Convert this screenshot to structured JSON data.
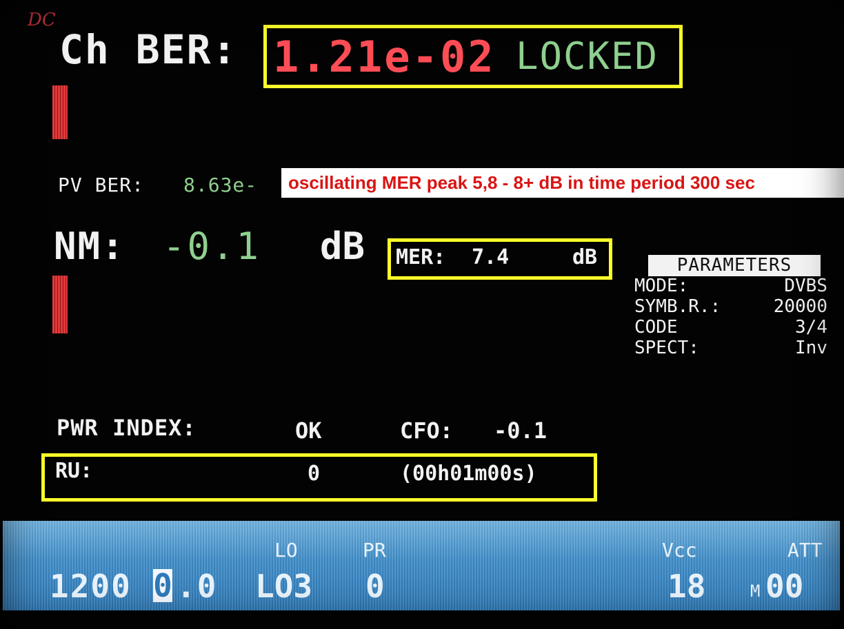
{
  "header": {
    "dc_label": "DC",
    "ch_ber_label": "Ch BER:",
    "ch_ber_value": "1.21e-02",
    "lock_status": "LOCKED"
  },
  "pv_ber": {
    "label": "PV BER:",
    "value": "8.63e-"
  },
  "annotation": "oscillating MER peak 5,8 - 8+ dB in time period 300 sec",
  "nm": {
    "label": "NM:",
    "value": "-0.1",
    "unit": "dB"
  },
  "mer": {
    "label": "MER:",
    "value": "7.4",
    "unit": "dB"
  },
  "parameters": {
    "title": "PARAMETERS",
    "rows": [
      {
        "key": "MODE:",
        "value": "DVBS"
      },
      {
        "key": "SYMB.R.:",
        "value": "20000"
      },
      {
        "key": "CODE",
        "value": "3/4"
      },
      {
        "key": "SPECT:",
        "value": "Inv"
      }
    ]
  },
  "pwr_index": {
    "label": "PWR INDEX:",
    "value": "OK"
  },
  "cfo": {
    "label": "CFO:",
    "value": "-0.1"
  },
  "ru": {
    "label": "RU:",
    "value": "0",
    "elapsed": "(00h01m00s)"
  },
  "status_bar": {
    "frequency_prefix": "1200",
    "frequency_cursor_digit": "0",
    "frequency_suffix": ".0",
    "lo_label": "LO",
    "lo_value": "LO3",
    "pr_label": "PR",
    "pr_value": "0",
    "vcc_label": "Vcc",
    "vcc_value": "18",
    "att_label": "ATT",
    "att_mode": "M",
    "att_value": "00"
  },
  "colors": {
    "background": "#030303",
    "highlight_box": "#ffff2a",
    "ber_red": "#ff4d56",
    "value_green": "#8fcf8f",
    "status_bar_blue": "#3f8dc8"
  }
}
